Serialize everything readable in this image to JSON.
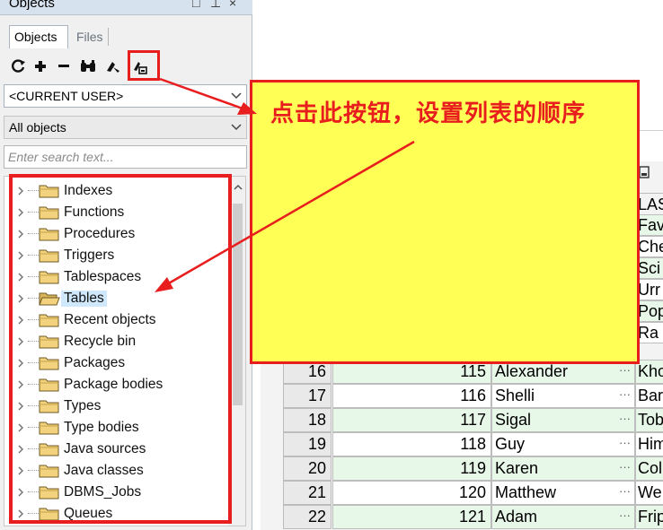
{
  "pane": {
    "title": "Objects",
    "controls": [
      "□",
      "⊥",
      "×"
    ],
    "tabs": [
      {
        "label": "Objects",
        "active": true
      },
      {
        "label": "Files",
        "active": false
      }
    ]
  },
  "toolbar": {
    "icons": [
      "refresh-icon",
      "add-icon",
      "remove-icon",
      "find-icon",
      "filter-icon",
      "sort-order-icon"
    ],
    "refresh": "⟳",
    "add": "✚",
    "remove": "━"
  },
  "user_combo": {
    "value": "<CURRENT USER>"
  },
  "type_combo": {
    "value": "All objects"
  },
  "search": {
    "placeholder": "Enter search text..."
  },
  "tree": {
    "items": [
      {
        "label": "Indexes",
        "selected": false
      },
      {
        "label": "Functions",
        "selected": false
      },
      {
        "label": "Procedures",
        "selected": false
      },
      {
        "label": "Triggers",
        "selected": false
      },
      {
        "label": "Tablespaces",
        "selected": false
      },
      {
        "label": "Tables",
        "selected": true
      },
      {
        "label": "Recent objects",
        "selected": false
      },
      {
        "label": "Recycle bin",
        "selected": false
      },
      {
        "label": "Packages",
        "selected": false
      },
      {
        "label": "Package bodies",
        "selected": false
      },
      {
        "label": "Types",
        "selected": false
      },
      {
        "label": "Type bodies",
        "selected": false
      },
      {
        "label": "Java sources",
        "selected": false
      },
      {
        "label": "Java classes",
        "selected": false
      },
      {
        "label": "DBMS_Jobs",
        "selected": false
      },
      {
        "label": "Queues",
        "selected": false
      }
    ]
  },
  "grid": {
    "partial_column_header": "LAS",
    "visible_last_fragments": [
      "Fav",
      "Che",
      "Sci",
      "Urr",
      "Pop",
      "Ra"
    ],
    "rows": [
      {
        "num": "16",
        "id": "115",
        "name": "Alexander",
        "last": "Kho"
      },
      {
        "num": "17",
        "id": "116",
        "name": "Shelli",
        "last": "Bar"
      },
      {
        "num": "18",
        "id": "117",
        "name": "Sigal",
        "last": "Tob"
      },
      {
        "num": "19",
        "id": "118",
        "name": "Guy",
        "last": "Him"
      },
      {
        "num": "20",
        "id": "119",
        "name": "Karen",
        "last": "Col"
      },
      {
        "num": "21",
        "id": "120",
        "name": "Matthew",
        "last": "We"
      },
      {
        "num": "22",
        "id": "121",
        "name": "Adam",
        "last": "Frip"
      }
    ],
    "ellipsis": "···"
  },
  "annotation": {
    "callout_text": "点击此按钮，设置列表的顺序",
    "color": "#e81e1e",
    "callout_bg": "#ffff55"
  }
}
